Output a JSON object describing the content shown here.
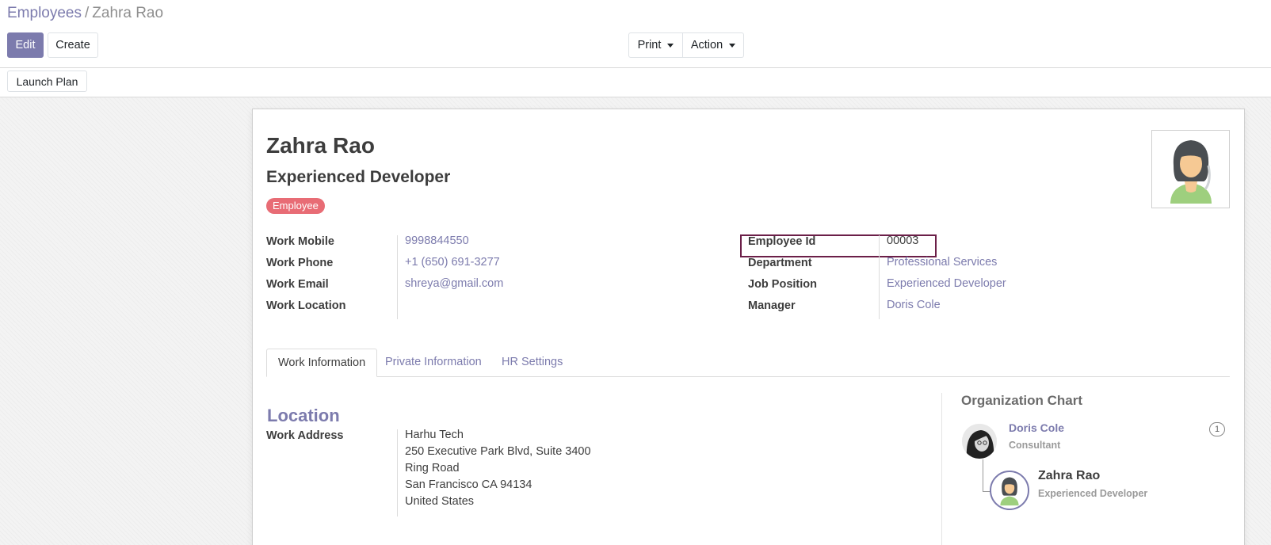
{
  "breadcrumb": {
    "parent": "Employees",
    "separator": "/",
    "current": "Zahra Rao"
  },
  "toolbar": {
    "edit_label": "Edit",
    "create_label": "Create",
    "print_label": "Print",
    "action_label": "Action"
  },
  "statusbar": {
    "launch_plan_label": "Launch Plan"
  },
  "employee": {
    "name": "Zahra Rao",
    "job_title": "Experienced Developer",
    "tag": "Employee"
  },
  "left_fields": [
    {
      "label": "Work Mobile",
      "value": "9998844550"
    },
    {
      "label": "Work Phone",
      "value": "+1 (650) 691-3277"
    },
    {
      "label": "Work Email",
      "value": "shreya@gmail.com"
    },
    {
      "label": "Work Location",
      "value": ""
    }
  ],
  "right_fields": [
    {
      "label": "Employee Id",
      "value": "00003"
    },
    {
      "label": "Department",
      "value": "Professional Services"
    },
    {
      "label": "Job Position",
      "value": "Experienced Developer"
    },
    {
      "label": "Manager",
      "value": "Doris Cole"
    }
  ],
  "tabs": [
    {
      "label": "Work Information",
      "active": true
    },
    {
      "label": "Private Information",
      "active": false
    },
    {
      "label": "HR Settings",
      "active": false
    }
  ],
  "location": {
    "title": "Location",
    "work_address_label": "Work Address",
    "company": "Harhu Tech",
    "lines": [
      "250 Executive Park Blvd, Suite 3400",
      "Ring Road",
      "San Francisco CA 94134",
      "United States"
    ]
  },
  "org_chart": {
    "title": "Organization Chart",
    "manager": {
      "name": "Doris Cole",
      "title": "Consultant",
      "count": "1"
    },
    "employee": {
      "name": "Zahra Rao",
      "title": "Experienced Developer"
    }
  },
  "colors": {
    "accent": "#7c7bad",
    "tag": "#e86c75",
    "highlight_border": "#6b1f48"
  }
}
